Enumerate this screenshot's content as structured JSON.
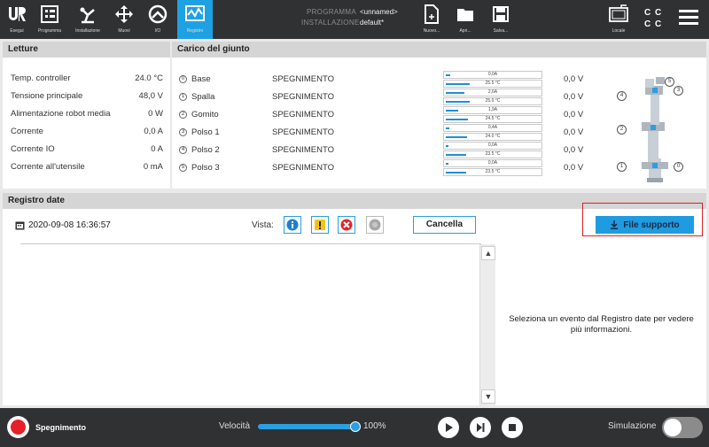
{
  "header": {
    "nav": [
      {
        "label": "Esegui",
        "icon": "ur-logo-icon"
      },
      {
        "label": "Programma",
        "icon": "program-icon"
      },
      {
        "label": "Installazione",
        "icon": "installation-icon"
      },
      {
        "label": "Muovi",
        "icon": "move-icon"
      },
      {
        "label": "I/O",
        "icon": "io-icon"
      },
      {
        "label": "Registro",
        "icon": "log-icon"
      }
    ],
    "program_key": "PROGRAMMA",
    "program_value": "<unnamed>",
    "install_key": "INSTALLAZIONE",
    "install_value": "default*",
    "file_buttons": [
      {
        "label": "Nuovo...",
        "icon": "new-file-icon"
      },
      {
        "label": "Apri...",
        "icon": "open-folder-icon"
      },
      {
        "label": "Salva...",
        "icon": "save-icon"
      }
    ],
    "locale_label": "Locale",
    "cc_top": "C C",
    "cc_bottom": "C C"
  },
  "letture": {
    "title": "Letture",
    "rows": [
      {
        "label": "Temp. controller",
        "value": "24.0 °C"
      },
      {
        "label": "Tensione principale",
        "value": "48,0 V"
      },
      {
        "label": "Alimentazione robot media",
        "value": "0 W"
      },
      {
        "label": "Corrente",
        "value": "0,0 A"
      },
      {
        "label": "Corrente IO",
        "value": "0 A"
      },
      {
        "label": "Corrente all'utensile",
        "value": "0 mA"
      }
    ]
  },
  "carico": {
    "title": "Carico del giunto",
    "joints": [
      {
        "num": "0",
        "name": "Base",
        "state": "SPEGNIMENTO",
        "current": "0,0A",
        "temp": "25.5 °C",
        "current_level": 0.05,
        "temp_level": 0.25,
        "voltage": "0,0 V"
      },
      {
        "num": "1",
        "name": "Spalla",
        "state": "SPEGNIMENTO",
        "current": "2,6A",
        "temp": "25.0 °C",
        "current_level": 0.2,
        "temp_level": 0.25,
        "voltage": "0,0 V"
      },
      {
        "num": "2",
        "name": "Gomito",
        "state": "SPEGNIMENTO",
        "current": "1,9A",
        "temp": "24.5 °C",
        "current_level": 0.13,
        "temp_level": 0.24,
        "voltage": "0,0 V"
      },
      {
        "num": "3",
        "name": "Polso 1",
        "state": "SPEGNIMENTO",
        "current": "0,4A",
        "temp": "24.0 °C",
        "current_level": 0.04,
        "temp_level": 0.23,
        "voltage": "0,0 V"
      },
      {
        "num": "4",
        "name": "Polso 2",
        "state": "SPEGNIMENTO",
        "current": "0,0A",
        "temp": "23.5 °C",
        "current_level": 0.03,
        "temp_level": 0.22,
        "voltage": "0,0 V"
      },
      {
        "num": "5",
        "name": "Polso 3",
        "state": "SPEGNIMENTO",
        "current": "0,0A",
        "temp": "23.5 °C",
        "current_level": 0.03,
        "temp_level": 0.22,
        "voltage": "0,0 V"
      }
    ],
    "robot_labels": [
      "5",
      "3",
      "4",
      "2",
      "1",
      "0"
    ]
  },
  "registro": {
    "title": "Registro date",
    "date": "2020-09-08 16:36:57",
    "vista_label": "Vista:",
    "cancel_label": "Cancella",
    "support_label": "File supporto",
    "detail_text": "Seleziona un evento dal Registro date per vedere più informazioni."
  },
  "footer": {
    "state": "Spegnimento",
    "speed_label": "Velocità",
    "speed_value": "100%",
    "speed_level": 1.0,
    "sim_label": "Simulazione"
  },
  "colors": {
    "accent": "#1ea1e3",
    "header_bg": "#2f3133",
    "power_red": "#e5202a",
    "highlight_outline": "#e02020"
  }
}
